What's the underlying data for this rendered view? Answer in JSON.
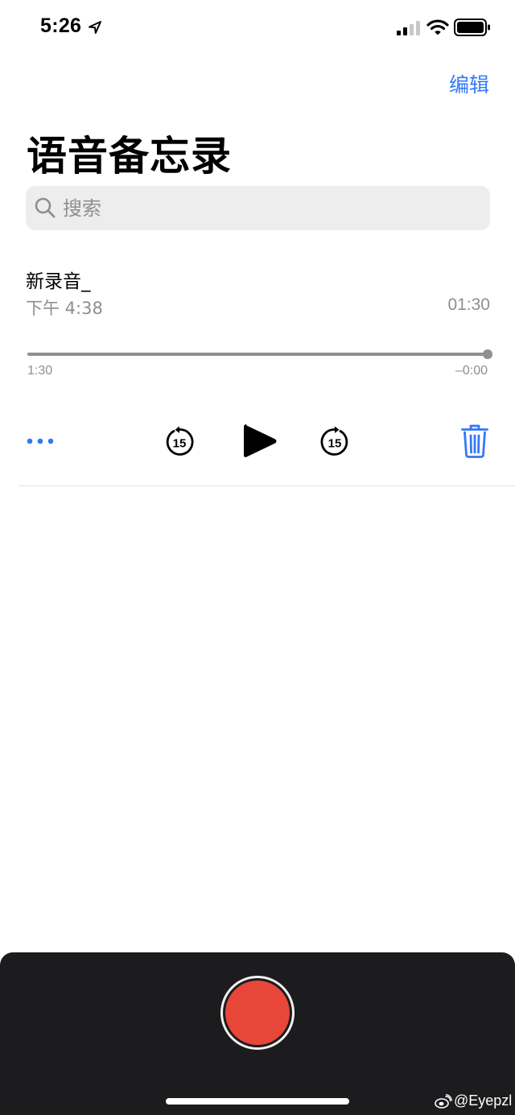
{
  "status_bar": {
    "time": "5:26",
    "icons": [
      "location-arrow-icon",
      "cellular-signal-icon",
      "wifi-icon",
      "battery-icon"
    ]
  },
  "header": {
    "edit_label": "编辑",
    "title": "语音备忘录"
  },
  "search": {
    "placeholder": "搜索",
    "value": ""
  },
  "recording": {
    "title": "新录音_",
    "date": "下午 4:38",
    "duration": "01:30",
    "elapsed": "1:30",
    "remaining": "–0:00",
    "progress": 1.0
  },
  "controls": {
    "more_icon": "ellipsis-icon",
    "skip_back_label": "15",
    "play_icon": "play-icon",
    "skip_forward_label": "15",
    "delete_icon": "trash-icon"
  },
  "colors": {
    "accent": "#3478f6",
    "record": "#e9463a",
    "panel": "#1c1c1e"
  },
  "watermark": {
    "text": "@Eyepzl"
  }
}
